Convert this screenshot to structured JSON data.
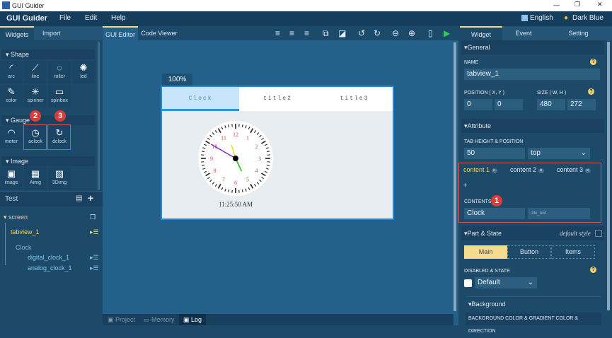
{
  "window": {
    "title": "GUI Guider",
    "minimize": "—",
    "restore": "❐",
    "close": "✕"
  },
  "menubar": {
    "app_name": "GUI Guider",
    "items": [
      "File",
      "Edit",
      "Help"
    ],
    "language": "English",
    "theme": "Dark Blue"
  },
  "left_panel": {
    "tabs": [
      "Widgets",
      "Import"
    ],
    "sections": [
      {
        "title": "Shape",
        "widgets": [
          {
            "label": "arc",
            "icon": "◜"
          },
          {
            "label": "line",
            "icon": "⟋"
          },
          {
            "label": "roller",
            "icon": "◌"
          },
          {
            "label": "led",
            "icon": "✺"
          },
          {
            "label": "color",
            "icon": "✎"
          },
          {
            "label": "spinner",
            "icon": "✳"
          },
          {
            "label": "spinbox",
            "icon": "▭"
          }
        ]
      },
      {
        "title": "Gauge",
        "widgets": [
          {
            "label": "meter",
            "icon": "◠"
          },
          {
            "label": "aclock",
            "icon": "◷"
          },
          {
            "label": "dclock",
            "icon": "↻"
          }
        ]
      },
      {
        "title": "Image",
        "widgets": [
          {
            "label": "image",
            "icon": "▣"
          },
          {
            "label": "Aimg",
            "icon": "▦"
          },
          {
            "label": "3Dimg",
            "icon": "▧"
          }
        ]
      }
    ],
    "badges": [
      "2",
      "3"
    ],
    "project": {
      "name": "Test",
      "tree": [
        {
          "label": "screen"
        },
        {
          "label": "tabview_1"
        },
        {
          "label": "Clock"
        },
        {
          "label": "digital_clock_1"
        },
        {
          "label": "analog_clock_1"
        }
      ]
    }
  },
  "center": {
    "tabs": [
      "GUI Editor",
      "Code Viewer"
    ],
    "zoom": "100%",
    "tabview": {
      "tabs": [
        "Clock",
        "title2",
        "title3"
      ],
      "time": "11:25:50 AM",
      "clock_numbers": [
        "12",
        "1",
        "2",
        "3",
        "4",
        "5",
        "6",
        "7",
        "8",
        "9",
        "10",
        "11"
      ]
    },
    "bottom_tabs": [
      "Project",
      "Memory",
      "Log"
    ]
  },
  "right_panel": {
    "tabs": [
      "Widget",
      "Event",
      "Setting"
    ],
    "general": {
      "title": "General",
      "name_label": "NAME",
      "name": "tabview_1",
      "position_label": "POSITION ( X, Y )",
      "x": "0",
      "y": "0",
      "size_label": "SIZE ( W, H )",
      "w": "480",
      "h": "272"
    },
    "attribute": {
      "title": "Attribute",
      "tab_label": "TAB HEIGHT & POSITION",
      "tab_height": "50",
      "tab_position": "top",
      "contents": [
        "content 1",
        "content 2",
        "content 3"
      ],
      "add": "+",
      "contents_label": "CONTENTS",
      "badge": "1",
      "content_value": "Clock",
      "content_placeholder": "title_text"
    },
    "part_state": {
      "title": "Part & State",
      "default_style": "default style",
      "parts": [
        "Main",
        "Button",
        "Items"
      ],
      "disabled_label": "DISABLED & STATE",
      "state": "Default"
    },
    "background": {
      "title": "Background",
      "label": "BACKGROUND COLOR & GRADIENT COLOR & DIRECTION"
    }
  },
  "colors": {
    "accent": "#f5dc8c",
    "highlight_box": "#d9534f",
    "tab_active": "#c7e4fb"
  }
}
